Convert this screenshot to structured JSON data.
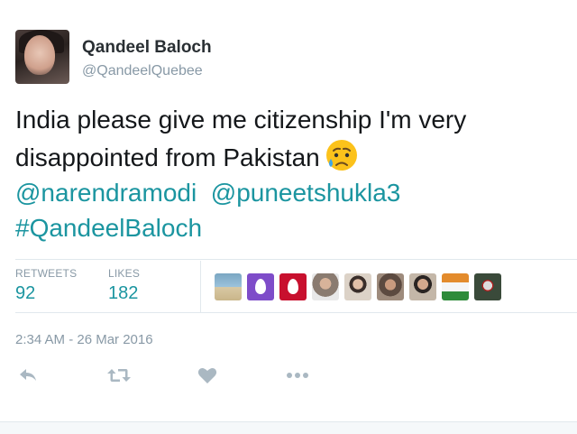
{
  "user": {
    "display_name": "Qandeel Baloch",
    "handle": "@QandeelQuebee"
  },
  "tweet": {
    "line1": "India please give me citizenship  I'm very",
    "line2": "disappointed from Pakistan",
    "emoji_icon": "sad-crying-face-icon",
    "mention1": "@narendramodi",
    "mention2": "@puneetshukla3",
    "hashtag": "#QandeelBaloch"
  },
  "stats": {
    "retweets_label": "RETWEETS",
    "retweets_value": "92",
    "likes_label": "LIKES",
    "likes_value": "182"
  },
  "likers": [
    {
      "name": "liker-avatar-beach",
      "color": "#7aa6c2"
    },
    {
      "name": "liker-avatar-egg-purple",
      "color": "#7e4cc9"
    },
    {
      "name": "liker-avatar-egg-red",
      "color": "#c8102e"
    },
    {
      "name": "liker-avatar-man-1",
      "color": "#8a7b70"
    },
    {
      "name": "liker-avatar-man-2",
      "color": "#c9b8a6"
    },
    {
      "name": "liker-avatar-man-3",
      "color": "#6f5c50"
    },
    {
      "name": "liker-avatar-man-4",
      "color": "#9b7d6a"
    },
    {
      "name": "liker-avatar-flag",
      "color": "#e38b2c"
    },
    {
      "name": "liker-avatar-joker",
      "color": "#3a4a3a"
    }
  ],
  "timestamp": "2:34 AM - 26 Mar 2016",
  "actions": {
    "reply_icon": "reply-icon",
    "retweet_icon": "retweet-icon",
    "like_icon": "heart-icon",
    "more_icon": "more-dots-icon"
  },
  "colors": {
    "link": "#1b95a0",
    "muted": "#8899a6",
    "icon": "#aab8c2"
  }
}
